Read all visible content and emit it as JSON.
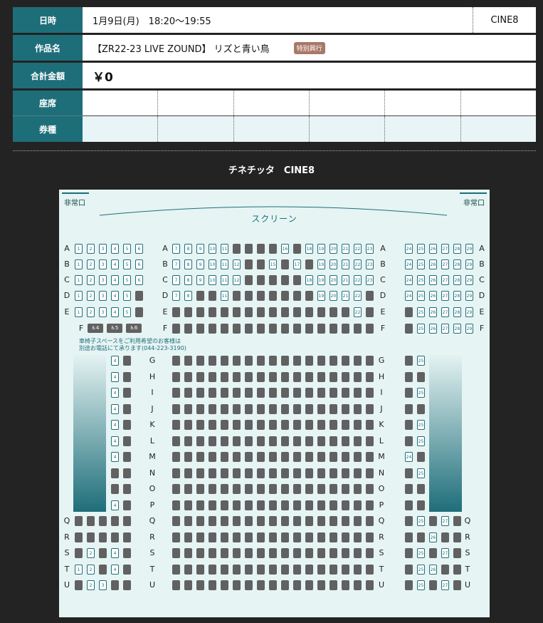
{
  "info": {
    "date_label": "日時",
    "date_value": "1月9日(月)　18:20～19:55",
    "theater_value": "CINE8",
    "title_label": "作品名",
    "title_value": "【ZR22-23 LIVE ZOUND】 リズと青い鳥",
    "title_badge": "特別興行",
    "total_label": "合計金額",
    "total_value": "￥0",
    "seat_label": "座席",
    "ticket_label": "券種"
  },
  "map": {
    "title": "チネチッタ　CINE8",
    "exit_left": "非常口",
    "exit_right": "非常口",
    "screen": "スクリーン",
    "note_line1": "車椅子スペースをご利用希望のお客様は",
    "note_line2": "別途お電話にて承ります(044-223-3190)",
    "wheelchairs": [
      "4",
      "5",
      "6"
    ]
  },
  "colors": {
    "accent": "#1e6e7a",
    "occupied": "#616161",
    "background": "#232323"
  }
}
